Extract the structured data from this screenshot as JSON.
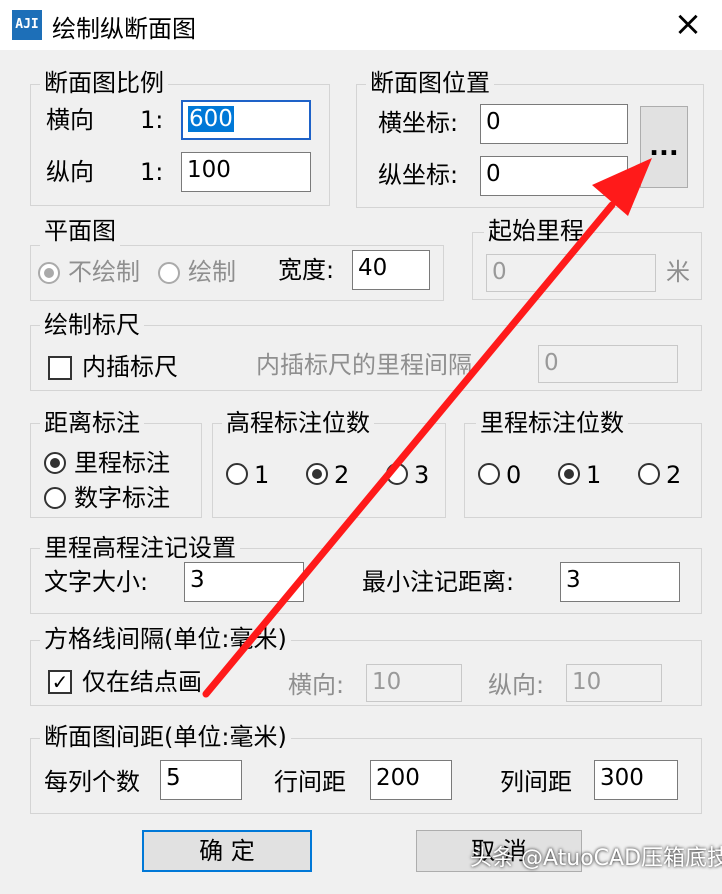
{
  "window": {
    "title": "绘制纵断面图",
    "icon_text": "AJI"
  },
  "scale": {
    "title": "断面图比例",
    "h_label": "横向",
    "h_prefix": "1:",
    "h_value": "600",
    "v_label": "纵向",
    "v_prefix": "1:",
    "v_value": "100"
  },
  "position": {
    "title": "断面图位置",
    "x_label": "横坐标:",
    "x_value": "0",
    "y_label": "纵坐标:",
    "y_value": "0",
    "browse_label": "..."
  },
  "plan": {
    "title": "平面图",
    "opt1": "不绘制",
    "opt2": "绘制",
    "width_label": "宽度:",
    "width_value": "40"
  },
  "start_mileage": {
    "title": "起始里程",
    "value": "0",
    "unit": "米"
  },
  "ruler": {
    "title": "绘制标尺",
    "interp_label": "内插标尺",
    "interval_label": "内插标尺的里程间隔",
    "interval_value": "0"
  },
  "distance": {
    "title": "距离标注",
    "opt1": "里程标注",
    "opt2": "数字标注"
  },
  "elev_digits": {
    "title": "高程标注位数",
    "opts": [
      "1",
      "2",
      "3"
    ]
  },
  "mile_digits": {
    "title": "里程标注位数",
    "opts": [
      "0",
      "1",
      "2"
    ]
  },
  "annot": {
    "title": "里程高程注记设置",
    "font_label": "文字大小:",
    "font_value": "3",
    "min_label": "最小注记距离:",
    "min_value": "3"
  },
  "grid": {
    "title": "方格线间隔(单位:毫米)",
    "node_only_label": "仅在结点画",
    "h_label": "横向:",
    "h_value": "10",
    "v_label": "纵向:",
    "v_value": "10"
  },
  "spacing": {
    "title": "断面图间距(单位:毫米)",
    "per_col_label": "每列个数",
    "per_col_value": "5",
    "row_label": "行间距",
    "row_value": "200",
    "col_label": "列间距",
    "col_value": "300"
  },
  "buttons": {
    "ok": "确    定",
    "cancel": "取    消"
  },
  "watermark": "头条 @AtuoCAD压箱底技巧",
  "colors": {
    "arrow": "#ff1a1a",
    "focus": "#1e62c8",
    "selection": "#0078d7"
  }
}
